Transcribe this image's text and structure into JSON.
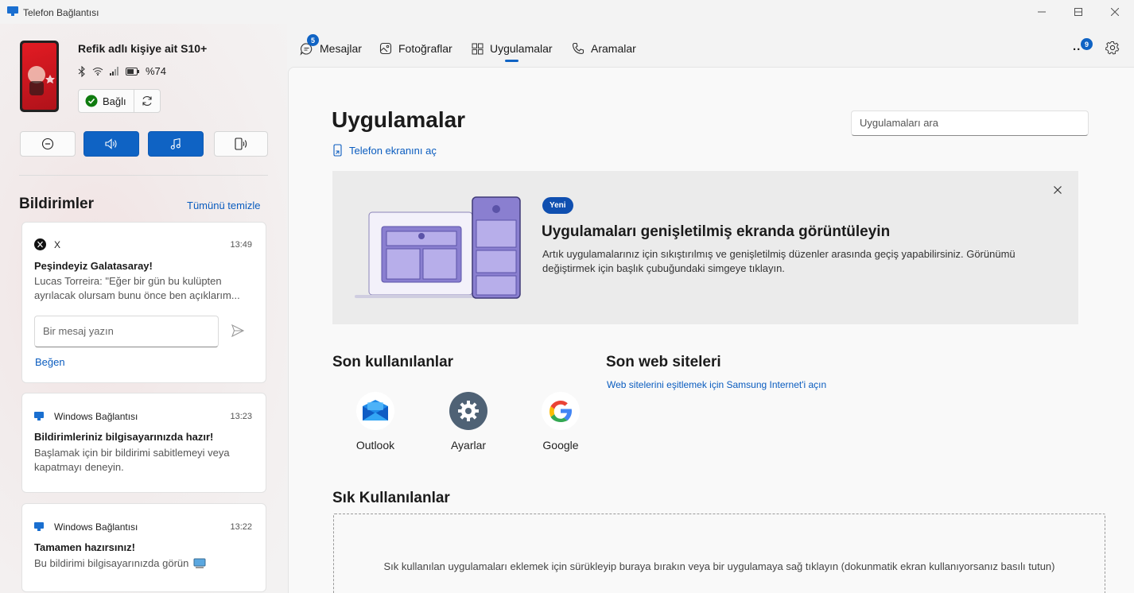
{
  "window": {
    "title": "Telefon Bağlantısı"
  },
  "device": {
    "name": "Refik adlı kişiye ait S10+",
    "battery": "%74",
    "connection_label": "Bağlı"
  },
  "tabs": [
    {
      "label": "Mesajlar",
      "badge": "5"
    },
    {
      "label": "Fotoğraflar"
    },
    {
      "label": "Uygulamalar"
    },
    {
      "label": "Aramalar"
    }
  ],
  "header": {
    "overflow_label": "..",
    "overflow_badge": "9"
  },
  "notifications": {
    "title": "Bildirimler",
    "clear_all": "Tümünü temizle",
    "items": [
      {
        "app": "X",
        "time": "13:49",
        "title": "Peşindeyiz Galatasaray!",
        "body": "Lucas Torreira: \"Eğer bir gün bu kulüpten ayrılacak olursam bunu önce ben açıklarım...",
        "reply_placeholder": "Bir mesaj yazın",
        "action": "Beğen"
      },
      {
        "app": "Windows Bağlantısı",
        "time": "13:23",
        "title": "Bildirimleriniz bilgisayarınızda hazır!",
        "body": "Başlamak için bir bildirimi sabitlemeyi veya kapatmayı deneyin."
      },
      {
        "app": "Windows Bağlantısı",
        "time": "13:22",
        "title": "Tamamen hazırsınız!",
        "body": "Bu bildirimi bilgisayarınızda görün"
      }
    ]
  },
  "main": {
    "title": "Uygulamalar",
    "open_screen": "Telefon ekranını aç",
    "search_placeholder": "Uygulamaları ara",
    "banner": {
      "badge": "Yeni",
      "title": "Uygulamaları genişletilmiş ekranda görüntüleyin",
      "body": "Artık uygulamalarınız için sıkıştırılmış ve genişletilmiş düzenler arasında geçiş yapabilirsiniz. Görünümü değiştirmek için başlık çubuğundaki simgeye tıklayın."
    },
    "recent": {
      "title": "Son kullanılanlar",
      "apps": [
        {
          "label": "Outlook",
          "icon": "outlook-icon"
        },
        {
          "label": "Ayarlar",
          "icon": "settings-app-icon"
        },
        {
          "label": "Google",
          "icon": "google-icon"
        }
      ]
    },
    "web": {
      "title": "Son web siteleri",
      "sync_link": "Web sitelerini eşitlemek için Samsung Internet'i açın"
    },
    "favorites": {
      "title": "Sık Kullanılanlar",
      "hint": "Sık kullanılan uygulamaları eklemek için sürükleyip buraya bırakın veya bir uygulamaya sağ tıklayın (dokunmatik ekran kullanıyorsanız basılı tutun)"
    }
  },
  "colors": {
    "accent": "#0f63c4",
    "link": "#0a5cbf"
  }
}
